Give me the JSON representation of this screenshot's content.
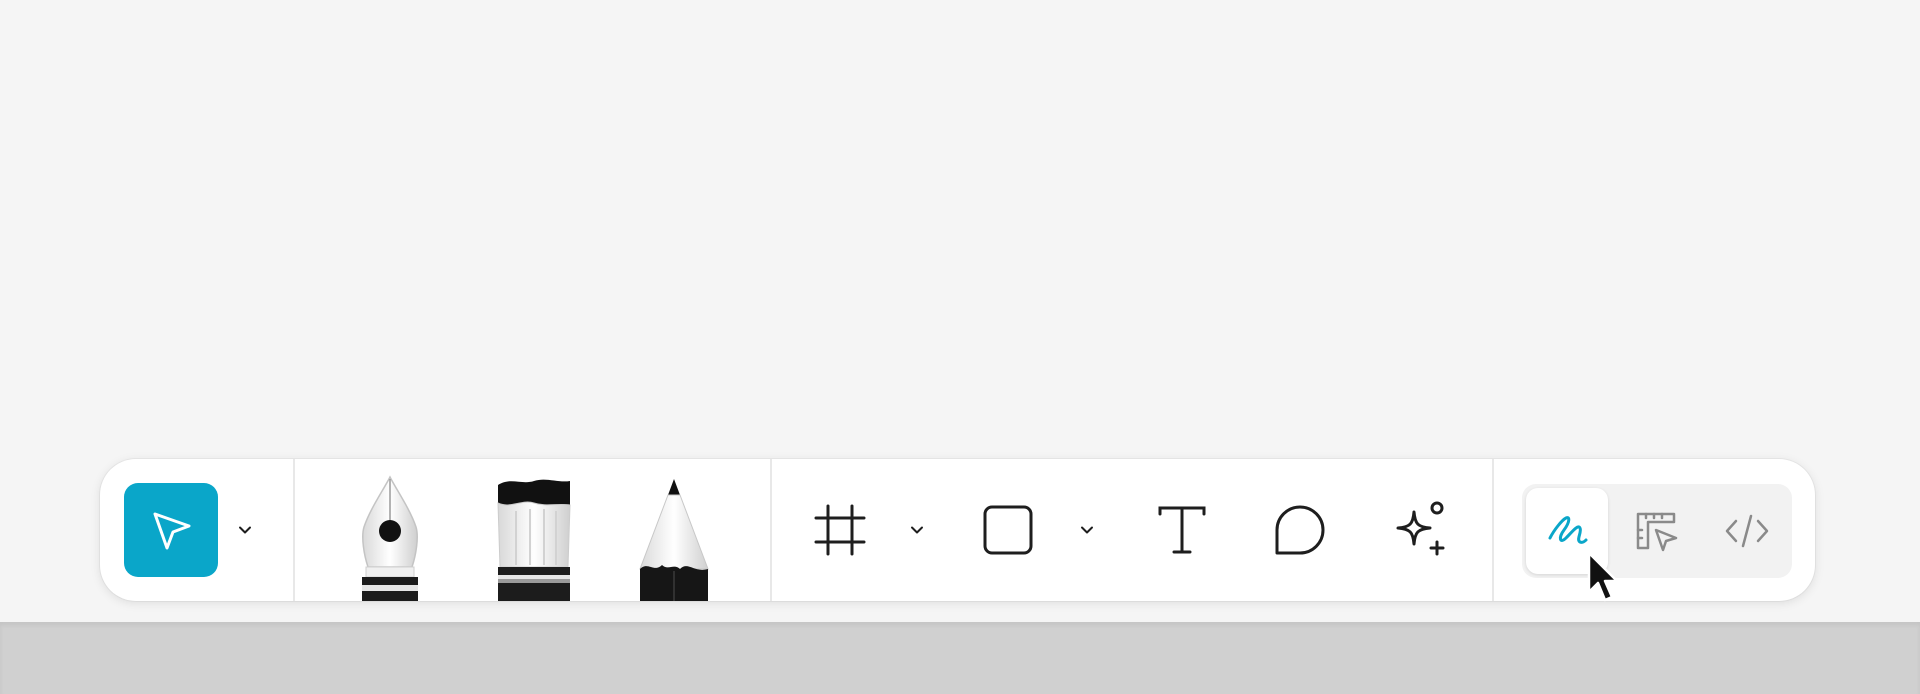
{
  "theme": {
    "accent": "#0aa6c9",
    "canvas_bg": "#f5f5f5",
    "toolbar_bg": "#ffffff",
    "icon_color": "#1e1e1e",
    "muted_icon_color": "#8a8a8a"
  },
  "toolbar": {
    "selection_group": {
      "active_tool": "move",
      "icons": [
        "cursor-arrow-icon",
        "chevron-down-icon"
      ]
    },
    "drawing_group": {
      "tools": [
        "pen",
        "brush",
        "pencil"
      ],
      "icons": [
        "fountain-pen-icon",
        "paint-brush-icon",
        "pencil-icon"
      ]
    },
    "shape_group": {
      "tools": [
        "frame",
        "rectangle",
        "text",
        "comment",
        "ai"
      ],
      "icons": [
        "frame-hash-icon",
        "chevron-down-icon",
        "rectangle-icon",
        "chevron-down-icon",
        "text-t-icon",
        "comment-bubble-icon",
        "sparkle-plus-icon"
      ]
    },
    "mode_switch": {
      "active_mode": "draw",
      "modes": [
        "draw",
        "design",
        "dev"
      ],
      "icons": [
        "squiggle-draw-icon",
        "ruler-cursor-icon",
        "code-brackets-icon"
      ]
    }
  },
  "pointer": {
    "icon": "mouse-pointer-icon"
  }
}
